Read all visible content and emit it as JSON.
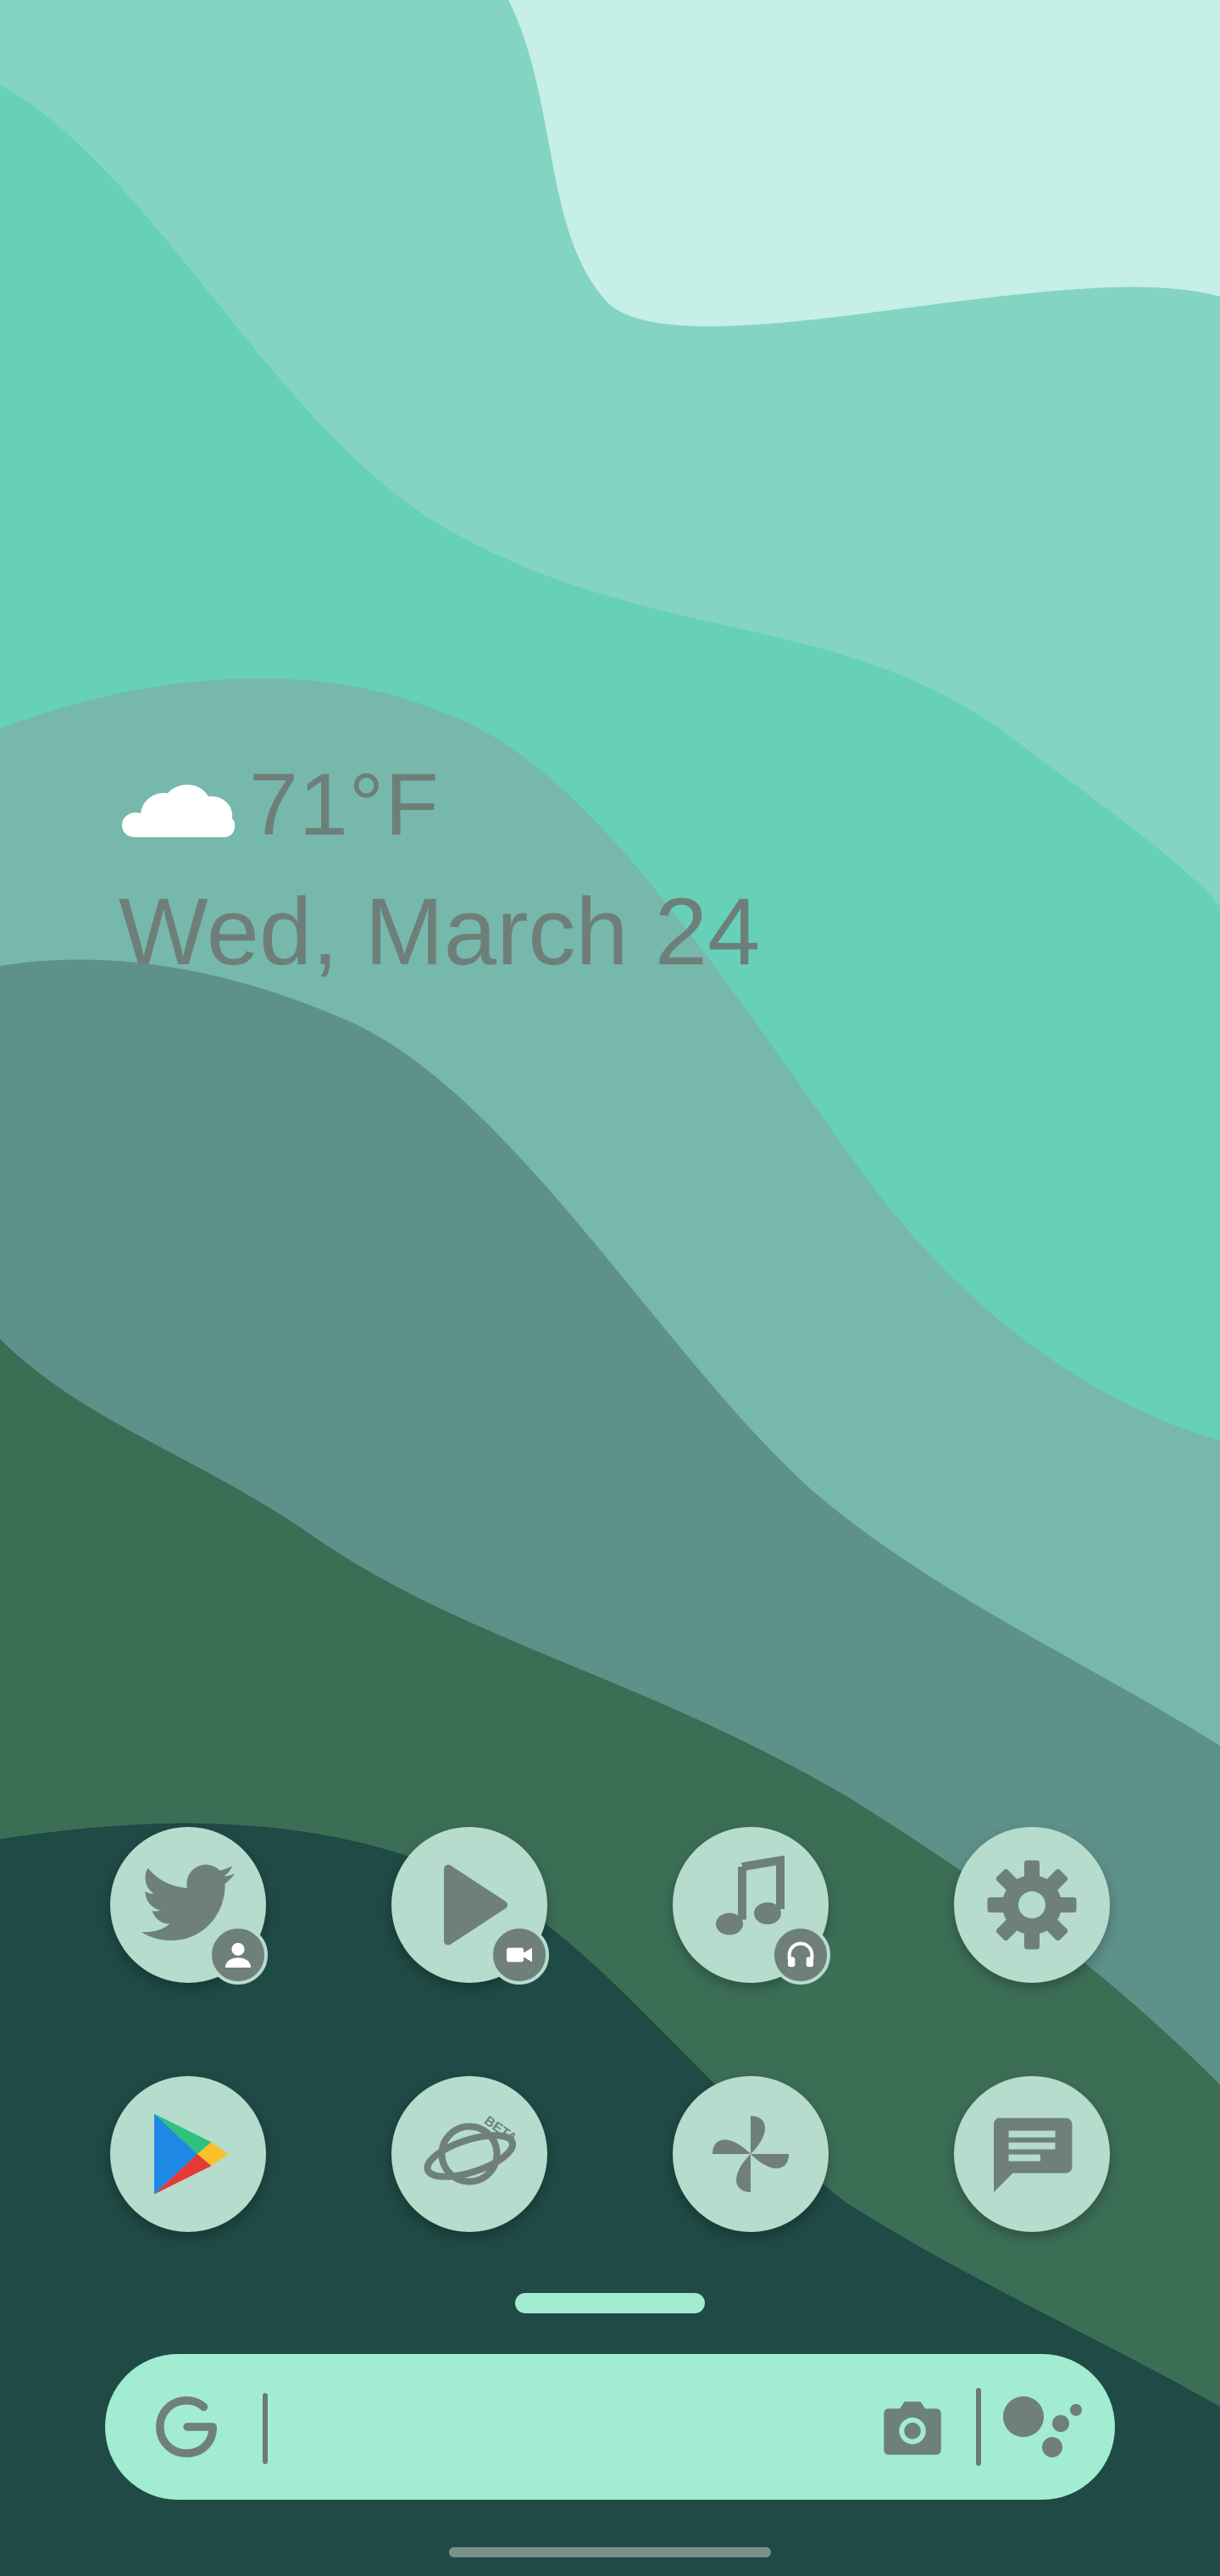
{
  "weather": {
    "temperature": "71°F",
    "condition_icon": "cloud-icon"
  },
  "date": "Wed, March 24",
  "dock_apps": [
    {
      "name": "Twitter",
      "icon": "twitter-bird-icon",
      "badge": "work-profile-person-icon"
    },
    {
      "name": "Play Movies",
      "icon": "play-triangle-icon",
      "badge": "video-camera-icon"
    },
    {
      "name": "Music",
      "icon": "music-note-icon",
      "badge": "headphones-icon"
    },
    {
      "name": "Settings",
      "icon": "gear-icon",
      "badge": null
    },
    {
      "name": "Play Store",
      "icon": "google-play-icon",
      "badge": null
    },
    {
      "name": "Samsung Internet Beta",
      "icon": "planet-beta-icon",
      "badge": null,
      "icon_text": "BETA"
    },
    {
      "name": "Pinwheel",
      "icon": "pinwheel-icon",
      "badge": null
    },
    {
      "name": "Messages",
      "icon": "message-icon",
      "badge": null
    }
  ],
  "search_bar": {
    "value": "",
    "left_icon": "google-g-icon",
    "right_icons": [
      "camera-lens-icon",
      "google-assistant-icon"
    ]
  },
  "colors": {
    "icon_bg": "#b5dccd",
    "icon_fg": "#6f7f79",
    "search_bg": "#a2ecd1",
    "text": "#6e7f79"
  }
}
